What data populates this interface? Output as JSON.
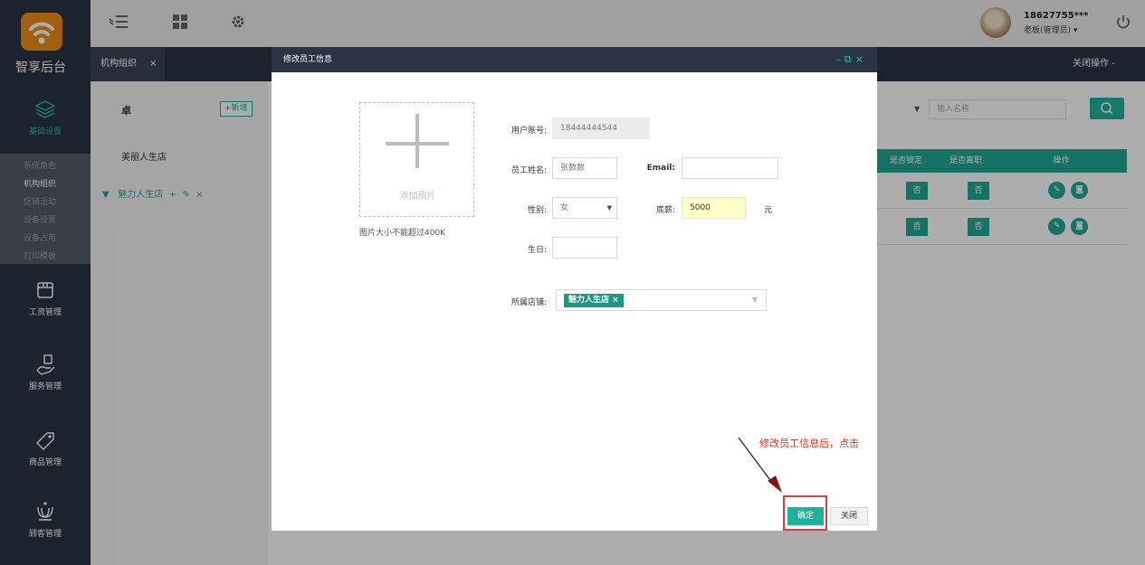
{
  "app": {
    "logo_text": "智享后台"
  },
  "sidebar": {
    "sections": [
      {
        "label": "基础设置",
        "icon": "layers-icon"
      },
      {
        "label": "工资管理",
        "icon": "wallet-icon"
      },
      {
        "label": "服务管理",
        "icon": "hand-service-icon"
      },
      {
        "label": "商品管理",
        "icon": "tag-icon"
      },
      {
        "label": "顾客管理",
        "icon": "crown-icon"
      }
    ],
    "submenu": [
      "系统角色",
      "机构组织",
      "促销活动",
      "设备设置",
      "设备占用",
      "打印模板"
    ]
  },
  "user": {
    "account": "18627755***",
    "role": "老板(管理员) ▾"
  },
  "tabs": {
    "active": "机构组织",
    "close": "×",
    "close_ops": "关闭操作 -"
  },
  "tree": {
    "title": "卓",
    "add_button": "+新增",
    "items": [
      "美丽人生店",
      "魅力人生店"
    ]
  },
  "table": {
    "search_placeholder": "输入名称",
    "headers": [
      "是否锁定",
      "是否离职",
      "操作"
    ],
    "rows": [
      {
        "locked": "否",
        "left": "否"
      },
      {
        "locked": "否",
        "left": "否"
      }
    ]
  },
  "dialog": {
    "title": "修改员工信息",
    "photo_label": "添加照片",
    "photo_note": "图片大小不能超过400K",
    "fields": {
      "account_label": "用户账号:",
      "account_value": "18444444544",
      "name_label": "员工姓名:",
      "name_value": "张数数",
      "email_label": "Email:",
      "email_value": "",
      "gender_label": "性别:",
      "gender_value": "女",
      "salary_label": "底薪:",
      "salary_value": "5000",
      "salary_unit": "元",
      "birthday_label": "生日:",
      "birthday_value": "",
      "store_label": "所属店铺:",
      "store_tag": "魅力人生店"
    },
    "confirm": "确定",
    "close": "关闭"
  },
  "annotation": "修改员工信息后，点击",
  "colors": {
    "accent": "#20a896",
    "sidebar": "#2b3444",
    "highlight": "#e23b3b"
  }
}
